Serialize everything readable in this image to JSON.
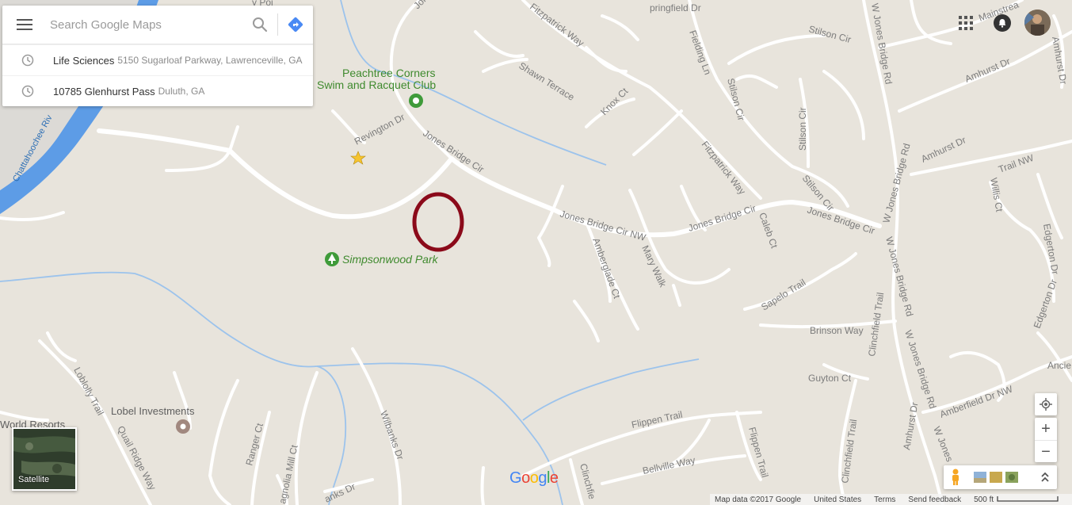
{
  "search": {
    "placeholder": "Search Google Maps",
    "history": [
      {
        "title": "Life Sciences",
        "subtitle": "5150 Sugarloaf Parkway, Lawrenceville, GA"
      },
      {
        "title": "10785 Glenhurst Pass",
        "subtitle": "Duluth, GA"
      }
    ]
  },
  "map": {
    "places": {
      "swim_club_line1": "Peachtree Corners",
      "swim_club_line2": "Swim and Racquet Club",
      "park": "Simpsonwood Park",
      "lobel": "Lobel Investments",
      "world_resorts": "World Resorts"
    },
    "river": "Chattahoochee Riv",
    "roads": {
      "revington": "Revington Dr",
      "jones_bridge_cir_1": "Jones Bridge Cir",
      "jones_bridge_cir_nw": "Jones Bridge Cir NW",
      "jones_bridge_cir_2": "Jones Bridge Cir",
      "jones_bridge_cir_3": "Jones Bridge Cir",
      "jones_top": "Jones",
      "fitzpatrick_1": "Fitzpatrick Way",
      "fitzpatrick_2": "Fitzpatrick Way",
      "shawn": "Shawn Terrace",
      "knox": "Knox Ct",
      "fielding": "Fielding Ln",
      "stilson_1": "Stilson Cir",
      "stilson_2": "Stilson Cir",
      "stilson_3": "Stilson Cir",
      "stilson_4": "Stilson Cir",
      "springfield": "pringfield Dr",
      "w_jones_1": "W Jones Bridge Rd",
      "w_jones_2": "W Jones Bridge Rd",
      "w_jones_3": "W Jones Bridge Rd",
      "w_jones_4": "W Jones Bridge Rd",
      "w_jones_5": "W Jones",
      "amhurst_1": "Amhurst Dr",
      "amhurst_2": "Amhurst Dr",
      "amhurst_3": "Amhurst Dr",
      "amhurst_4": "Amhurst Dr",
      "mainstream": "Mainstrea",
      "caleb": "Caleb Ct",
      "amberglade": "Amberglade Ct",
      "mary_walk": "Mary Walk",
      "sapelo": "Sapelo Trail",
      "brinson": "Brinson Way",
      "clinchfield_1": "Clinchfield Trail",
      "clinchfield_2": "Clinchfield Trail",
      "clinchfield_3": "Clinchfie",
      "guyton": "Guyton Ct",
      "amberfield": "Amberfield Dr NW",
      "edgerton_1": "Edgerton Dr",
      "edgerton_2": "Edgerton Dr",
      "ancie": "Ancie",
      "willis": "Willis Ct",
      "trail_nw": "Trail NW",
      "flippen_1": "Flippen Trail",
      "flippen_2": "Flippen Trail",
      "bellville": "Bellville Way",
      "loblolly": "Loblolly Trail",
      "quail": "Quail Ridge Way",
      "ranger": "Ranger Ct",
      "magnolia": "agnolia Mill Ct",
      "wilbanks_1": "Wilbanks Dr",
      "wilbanks_2": "anks Dr",
      "y_poi": "y Poi"
    }
  },
  "controls": {
    "satellite_label": "Satellite",
    "zoom_in": "+",
    "zoom_out": "−"
  },
  "footer": {
    "map_data": "Map data ©2017 Google",
    "country": "United States",
    "terms": "Terms",
    "feedback": "Send feedback",
    "scale": "500 ft"
  },
  "branding": {
    "logo": [
      "G",
      "o",
      "o",
      "g",
      "l",
      "e"
    ],
    "logo_colors": [
      "#4285f4",
      "#ea4335",
      "#fbbc05",
      "#4285f4",
      "#34a853",
      "#ea4335"
    ]
  },
  "colors": {
    "land": "#e8e4dc",
    "road": "#ffffff",
    "river": "#5d9ce6",
    "stream": "#9cc3ec",
    "park_green": "#3f8a2e",
    "marker_circle": "#8b0a1a",
    "star": "#f6c42e"
  }
}
